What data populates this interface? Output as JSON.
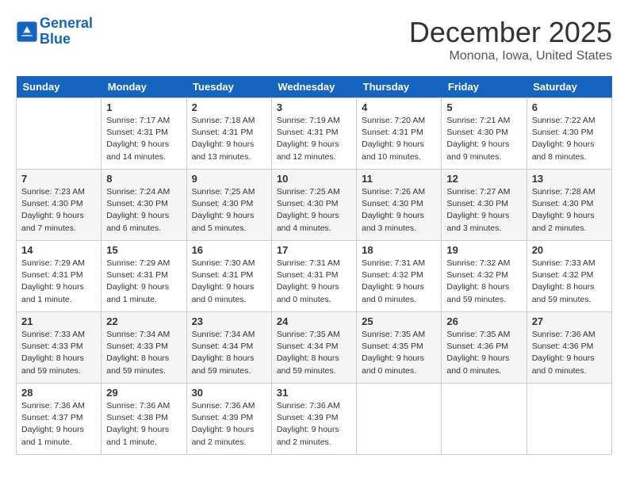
{
  "header": {
    "logo_line1": "General",
    "logo_line2": "Blue",
    "title": "December 2025",
    "subtitle": "Monona, Iowa, United States"
  },
  "days": [
    "Sunday",
    "Monday",
    "Tuesday",
    "Wednesday",
    "Thursday",
    "Friday",
    "Saturday"
  ],
  "weeks": [
    [
      {
        "date": "",
        "info": ""
      },
      {
        "date": "1",
        "info": "Sunrise: 7:17 AM\nSunset: 4:31 PM\nDaylight: 9 hours\nand 14 minutes."
      },
      {
        "date": "2",
        "info": "Sunrise: 7:18 AM\nSunset: 4:31 PM\nDaylight: 9 hours\nand 13 minutes."
      },
      {
        "date": "3",
        "info": "Sunrise: 7:19 AM\nSunset: 4:31 PM\nDaylight: 9 hours\nand 12 minutes."
      },
      {
        "date": "4",
        "info": "Sunrise: 7:20 AM\nSunset: 4:31 PM\nDaylight: 9 hours\nand 10 minutes."
      },
      {
        "date": "5",
        "info": "Sunrise: 7:21 AM\nSunset: 4:30 PM\nDaylight: 9 hours\nand 9 minutes."
      },
      {
        "date": "6",
        "info": "Sunrise: 7:22 AM\nSunset: 4:30 PM\nDaylight: 9 hours\nand 8 minutes."
      }
    ],
    [
      {
        "date": "7",
        "info": "Sunrise: 7:23 AM\nSunset: 4:30 PM\nDaylight: 9 hours\nand 7 minutes."
      },
      {
        "date": "8",
        "info": "Sunrise: 7:24 AM\nSunset: 4:30 PM\nDaylight: 9 hours\nand 6 minutes."
      },
      {
        "date": "9",
        "info": "Sunrise: 7:25 AM\nSunset: 4:30 PM\nDaylight: 9 hours\nand 5 minutes."
      },
      {
        "date": "10",
        "info": "Sunrise: 7:25 AM\nSunset: 4:30 PM\nDaylight: 9 hours\nand 4 minutes."
      },
      {
        "date": "11",
        "info": "Sunrise: 7:26 AM\nSunset: 4:30 PM\nDaylight: 9 hours\nand 3 minutes."
      },
      {
        "date": "12",
        "info": "Sunrise: 7:27 AM\nSunset: 4:30 PM\nDaylight: 9 hours\nand 3 minutes."
      },
      {
        "date": "13",
        "info": "Sunrise: 7:28 AM\nSunset: 4:30 PM\nDaylight: 9 hours\nand 2 minutes."
      }
    ],
    [
      {
        "date": "14",
        "info": "Sunrise: 7:29 AM\nSunset: 4:31 PM\nDaylight: 9 hours\nand 1 minute."
      },
      {
        "date": "15",
        "info": "Sunrise: 7:29 AM\nSunset: 4:31 PM\nDaylight: 9 hours\nand 1 minute."
      },
      {
        "date": "16",
        "info": "Sunrise: 7:30 AM\nSunset: 4:31 PM\nDaylight: 9 hours\nand 0 minutes."
      },
      {
        "date": "17",
        "info": "Sunrise: 7:31 AM\nSunset: 4:31 PM\nDaylight: 9 hours\nand 0 minutes."
      },
      {
        "date": "18",
        "info": "Sunrise: 7:31 AM\nSunset: 4:32 PM\nDaylight: 9 hours\nand 0 minutes."
      },
      {
        "date": "19",
        "info": "Sunrise: 7:32 AM\nSunset: 4:32 PM\nDaylight: 8 hours\nand 59 minutes."
      },
      {
        "date": "20",
        "info": "Sunrise: 7:33 AM\nSunset: 4:32 PM\nDaylight: 8 hours\nand 59 minutes."
      }
    ],
    [
      {
        "date": "21",
        "info": "Sunrise: 7:33 AM\nSunset: 4:33 PM\nDaylight: 8 hours\nand 59 minutes."
      },
      {
        "date": "22",
        "info": "Sunrise: 7:34 AM\nSunset: 4:33 PM\nDaylight: 8 hours\nand 59 minutes."
      },
      {
        "date": "23",
        "info": "Sunrise: 7:34 AM\nSunset: 4:34 PM\nDaylight: 8 hours\nand 59 minutes."
      },
      {
        "date": "24",
        "info": "Sunrise: 7:35 AM\nSunset: 4:34 PM\nDaylight: 8 hours\nand 59 minutes."
      },
      {
        "date": "25",
        "info": "Sunrise: 7:35 AM\nSunset: 4:35 PM\nDaylight: 9 hours\nand 0 minutes."
      },
      {
        "date": "26",
        "info": "Sunrise: 7:35 AM\nSunset: 4:36 PM\nDaylight: 9 hours\nand 0 minutes."
      },
      {
        "date": "27",
        "info": "Sunrise: 7:36 AM\nSunset: 4:36 PM\nDaylight: 9 hours\nand 0 minutes."
      }
    ],
    [
      {
        "date": "28",
        "info": "Sunrise: 7:36 AM\nSunset: 4:37 PM\nDaylight: 9 hours\nand 1 minute."
      },
      {
        "date": "29",
        "info": "Sunrise: 7:36 AM\nSunset: 4:38 PM\nDaylight: 9 hours\nand 1 minute."
      },
      {
        "date": "30",
        "info": "Sunrise: 7:36 AM\nSunset: 4:39 PM\nDaylight: 9 hours\nand 2 minutes."
      },
      {
        "date": "31",
        "info": "Sunrise: 7:36 AM\nSunset: 4:39 PM\nDaylight: 9 hours\nand 2 minutes."
      },
      {
        "date": "",
        "info": ""
      },
      {
        "date": "",
        "info": ""
      },
      {
        "date": "",
        "info": ""
      }
    ]
  ]
}
